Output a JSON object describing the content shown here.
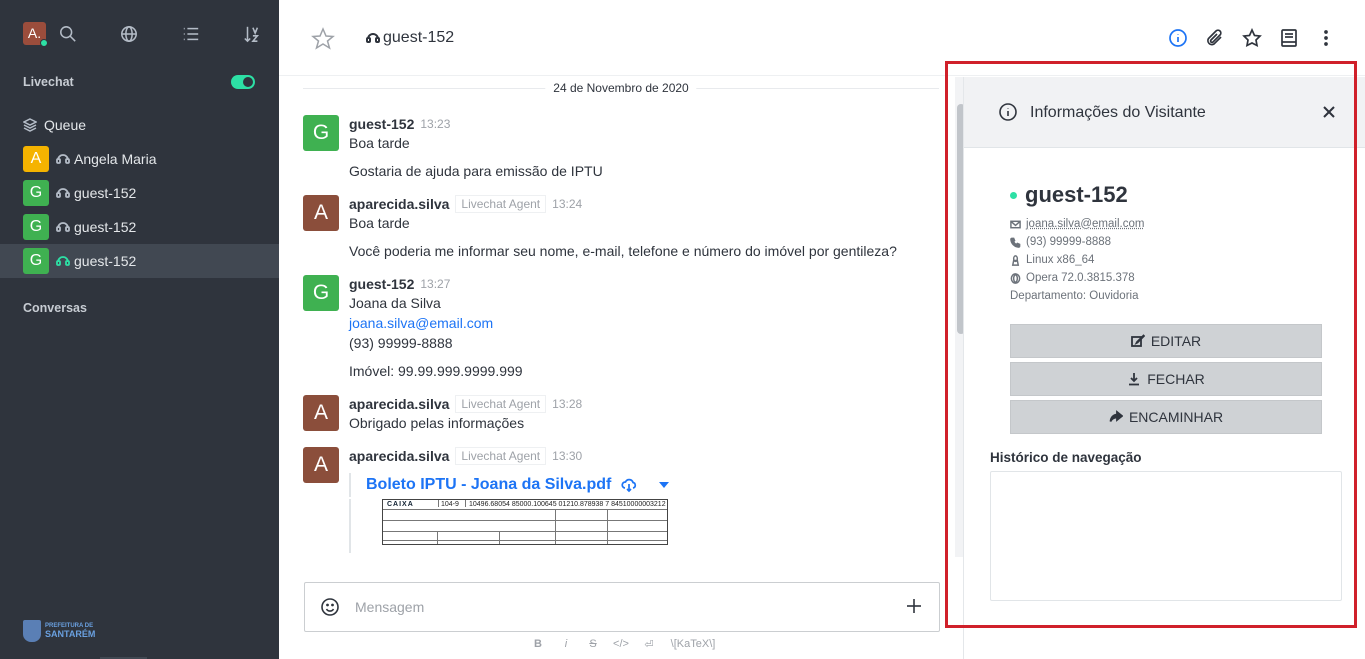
{
  "sidebar": {
    "user_initial": "A.",
    "livechat_label": "Livechat",
    "queue_label": "Queue",
    "rooms": [
      {
        "initial": "A",
        "name": "Angela Maria",
        "color": "#f5b300"
      },
      {
        "initial": "G",
        "name": "guest-152",
        "color": "#3fb151"
      },
      {
        "initial": "G",
        "name": "guest-152",
        "color": "#3fb151"
      },
      {
        "initial": "G",
        "name": "guest-152",
        "color": "#3fb151"
      }
    ],
    "conversas_label": "Conversas",
    "logo": {
      "line1": "PREFEITURA DE",
      "line2": "SANTARÉM"
    }
  },
  "header": {
    "room_name": "guest-152"
  },
  "messages": {
    "date": "24 de Novembro de 2020",
    "list": [
      {
        "initial": "G",
        "name": "guest-152",
        "role": "",
        "time": "13:23",
        "lines": [
          "Boa tarde"
        ],
        "extra": "Gostaria de ajuda para emissão de IPTU"
      },
      {
        "initial": "A",
        "name": "aparecida.silva",
        "role": "Livechat Agent",
        "time": "13:24",
        "lines": [
          "Boa tarde"
        ],
        "extra": "Você poderia me informar seu nome, e-mail, telefone e número do imóvel por gentileza?"
      },
      {
        "initial": "G",
        "name": "guest-152",
        "role": "",
        "time": "13:27",
        "lines": [
          "Joana da Silva",
          "joana.silva@email.com",
          "(93) 99999-8888"
        ],
        "extra": "Imóvel: 99.99.999.9999.999"
      },
      {
        "initial": "A",
        "name": "aparecida.silva",
        "role": "Livechat Agent",
        "time": "13:28",
        "lines": [
          "Obrigado pelas informações"
        ],
        "extra": ""
      },
      {
        "initial": "A",
        "name": "aparecida.silva",
        "role": "Livechat Agent",
        "time": "13:30",
        "lines": [],
        "extra": ""
      }
    ],
    "attachment": {
      "title": "Boleto IPTU - Joana da Silva.pdf",
      "bank_logo": "CAIXA",
      "bank_code": "104-9",
      "barcode_line": "10496.68054 85000.100645 01210.878938 7 84510000003212"
    }
  },
  "composer": {
    "placeholder": "Mensagem",
    "format": {
      "bold": "B",
      "italic": "i",
      "strike": "S",
      "code": "</>",
      "multiline": "⏎",
      "katex": "\\[KaTeX\\]"
    }
  },
  "panel": {
    "title": "Informações do Visitante",
    "visitor_name": "guest-152",
    "email": "joana.silva@email.com",
    "phone": "(93) 99999-8888",
    "os": "Linux x86_64",
    "browser": "Opera 72.0.3815.378",
    "department": "Departamento: Ouvidoria",
    "buttons": {
      "edit": "EDITAR",
      "close": "FECHAR",
      "forward": "ENCAMINHAR"
    },
    "nav_history_label": "Histórico de navegação"
  },
  "colors": {
    "accent": "#1d74f5",
    "online": "#2de0a5",
    "guest_avatar": "#3fb151",
    "agent_avatar": "#8b4e3b",
    "highlight": "#d0202a"
  }
}
